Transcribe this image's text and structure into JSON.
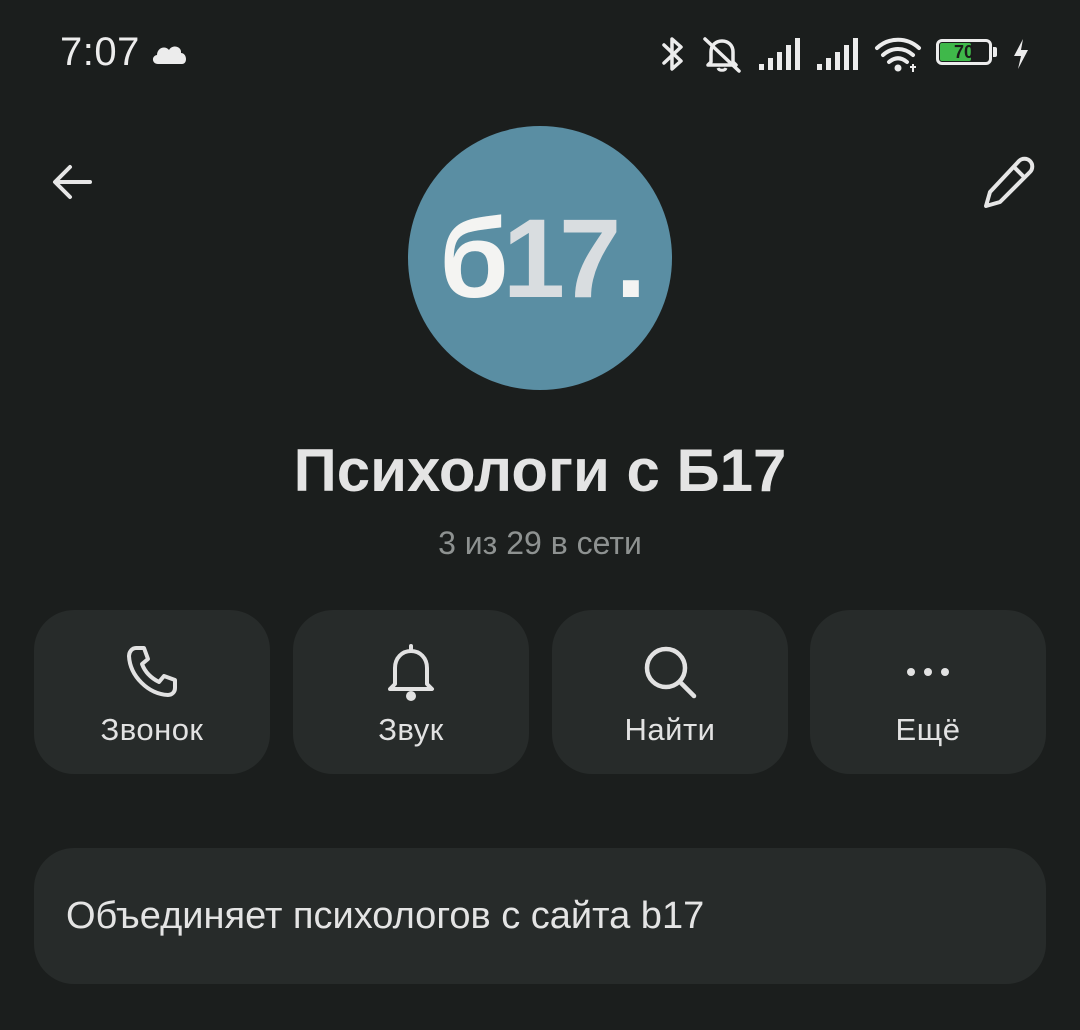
{
  "status_bar": {
    "time": "7:07",
    "battery_percent": "70",
    "battery_level": 0.7,
    "icons": [
      "cloud-icon",
      "bluetooth-icon",
      "muted-bell-icon",
      "signal-icon",
      "signal-icon",
      "wifi-icon",
      "battery-icon",
      "charging-icon"
    ]
  },
  "header": {
    "back_icon": "back-arrow-icon",
    "edit_icon": "pencil-icon"
  },
  "avatar": {
    "text_part1": "б",
    "text_part2": "17",
    "text_part3": ".",
    "background_color": "#5a8ea3"
  },
  "group": {
    "title": "Психологи с Б17",
    "subtitle": "3 из 29 в сети"
  },
  "actions": [
    {
      "label": "Звонок",
      "icon": "phone-icon"
    },
    {
      "label": "Звук",
      "icon": "bell-icon"
    },
    {
      "label": "Найти",
      "icon": "search-icon"
    },
    {
      "label": "Ещё",
      "icon": "more-icon"
    }
  ],
  "description": {
    "text": "Объединяет психологов с сайта b17"
  },
  "colors": {
    "background": "#1b1e1d",
    "card": "#272b2a",
    "battery_fill": "#3fb84a"
  }
}
